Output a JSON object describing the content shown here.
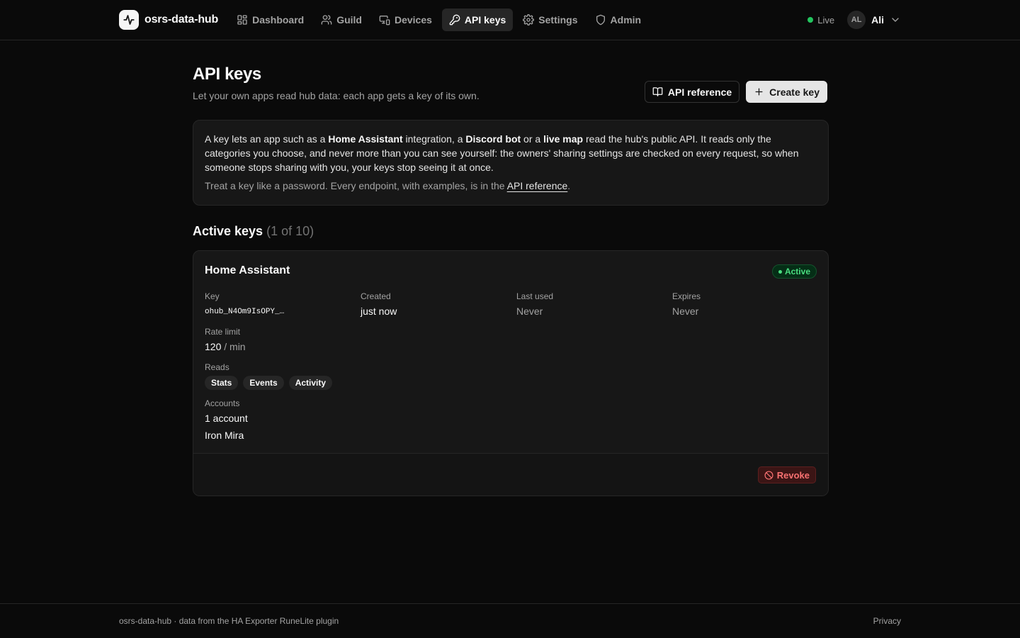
{
  "app": {
    "name": "osrs-data-hub"
  },
  "nav": {
    "items": [
      {
        "label": "Dashboard",
        "icon": "dashboard-icon"
      },
      {
        "label": "Guild",
        "icon": "users-icon"
      },
      {
        "label": "Devices",
        "icon": "devices-icon"
      },
      {
        "label": "API keys",
        "icon": "key-icon",
        "active": true
      },
      {
        "label": "Settings",
        "icon": "gear-icon"
      },
      {
        "label": "Admin",
        "icon": "shield-icon"
      }
    ]
  },
  "header": {
    "live_label": "Live",
    "user": {
      "initials": "AL",
      "name": "Ali"
    }
  },
  "page": {
    "title": "API keys",
    "subtitle": "Let your own apps read hub data: each app gets a key of its own.",
    "api_reference_button": "API reference",
    "create_key_button": "Create key"
  },
  "info": {
    "p1": "A key lets an app such as a ",
    "b1": "Home Assistant",
    "p2": " integration, a ",
    "b2": "Discord bot",
    "p3": " or a ",
    "b3": "live map",
    "p4": " read the hub's public API. It reads only the categories you choose, and never more than you can see yourself: the owners' sharing settings are checked on every request, so when someone stops sharing with you, your keys stop seeing it at once.",
    "note": "Treat a key like a password. Every endpoint, with examples, is in the ",
    "note_link": "API reference",
    "note_end": "."
  },
  "active_keys": {
    "title": "Active keys",
    "count": "(1 of 10)",
    "keys": [
      {
        "name": "Home Assistant",
        "status": "Active",
        "key_label": "Key",
        "key_value": "ohub_N4Om9IsOPY_…",
        "created_label": "Created",
        "created_value": "just now",
        "last_used_label": "Last used",
        "last_used_value": "Never",
        "expires_label": "Expires",
        "expires_value": "Never",
        "rate_limit_label": "Rate limit",
        "rate_limit_value": "120",
        "rate_limit_unit": " / min",
        "reads_label": "Reads",
        "reads": [
          "Stats",
          "Events",
          "Activity"
        ],
        "accounts_label": "Accounts",
        "accounts_count": "1 account",
        "accounts": [
          "Iron Mira"
        ],
        "revoke_label": "Revoke"
      }
    ]
  },
  "footer": {
    "text": "osrs-data-hub · data from the HA Exporter RuneLite plugin",
    "privacy": "Privacy"
  },
  "colors": {
    "background": "#0a0a0a",
    "card": "#171717",
    "border": "#262626",
    "live": "#22c55e",
    "active_badge": "#4ade80",
    "danger": "#f87171"
  }
}
